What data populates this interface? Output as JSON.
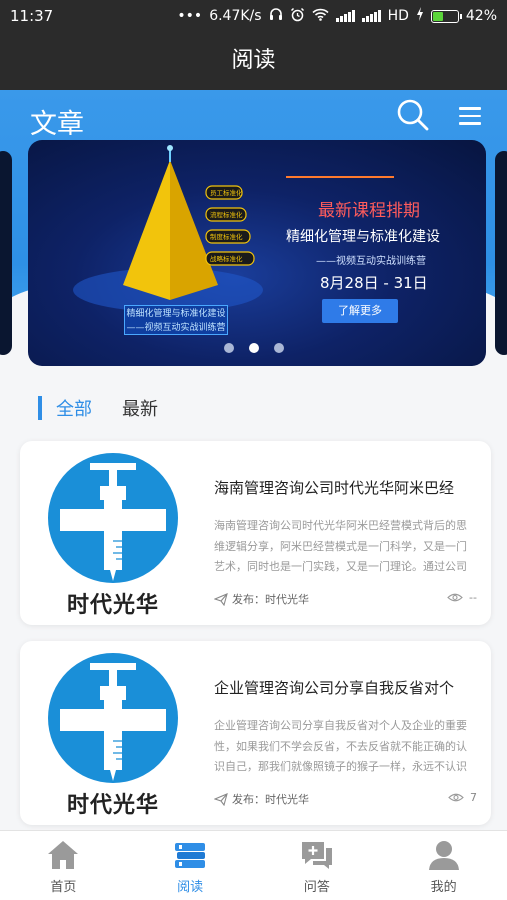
{
  "status": {
    "time": "11:37",
    "speed": "6.47K/s",
    "network": "HD",
    "battery": "42%",
    "battery_level": 0.42
  },
  "appbar": {
    "title": "阅读"
  },
  "header": {
    "title": "文章"
  },
  "banner": {
    "headline": "最新课程排期",
    "sub": "精细化管理与标准化建设",
    "note": "——视频互动实战训练营",
    "date": "8月28日 - 31日",
    "cta": "了解更多",
    "pyramid_caption": "精细化管理与标准化建设",
    "pyramid_caption2": "——视频互动实战训练营",
    "pyramid_labels": [
      "员工标准化",
      "流程标准化",
      "制度标准化",
      "战略标准化"
    ],
    "page_count": 3,
    "active_page": 1
  },
  "tabs": [
    {
      "label": "全部",
      "active": true
    },
    {
      "label": "最新",
      "active": false
    }
  ],
  "articles": [
    {
      "brand": "时代光华",
      "title": "海南管理咨询公司时代光华阿米巴经",
      "desc": "海南管理咨询公司时代光华阿米巴经营模式背后的思维逻辑分享，阿米巴经营模式是一门科学，又是一门艺术，同时也是一门实践，又是一门理论。通过公司的细...",
      "publisher": "发布：时代光华",
      "views": "--"
    },
    {
      "brand": "时代光华",
      "title": "企业管理咨询公司分享自我反省对个",
      "desc": "企业管理咨询公司分享自我反省对个人及企业的重要性，如果我们不学会反省，不去反省就不能正确的认识自己，那我们就像照镜子的猴子一样，永远不认识",
      "publisher": "发布：时代光华",
      "views": "7"
    }
  ],
  "tabbar": [
    {
      "label": "首页",
      "icon": "home-icon",
      "active": false
    },
    {
      "label": "阅读",
      "icon": "books-icon",
      "active": true
    },
    {
      "label": "问答",
      "icon": "qa-icon",
      "active": false
    },
    {
      "label": "我的",
      "icon": "user-icon",
      "active": false
    }
  ],
  "colors": {
    "accent": "#2f8ee6",
    "header_blue": "#3a99ea",
    "dark": "#2b2b2b"
  }
}
